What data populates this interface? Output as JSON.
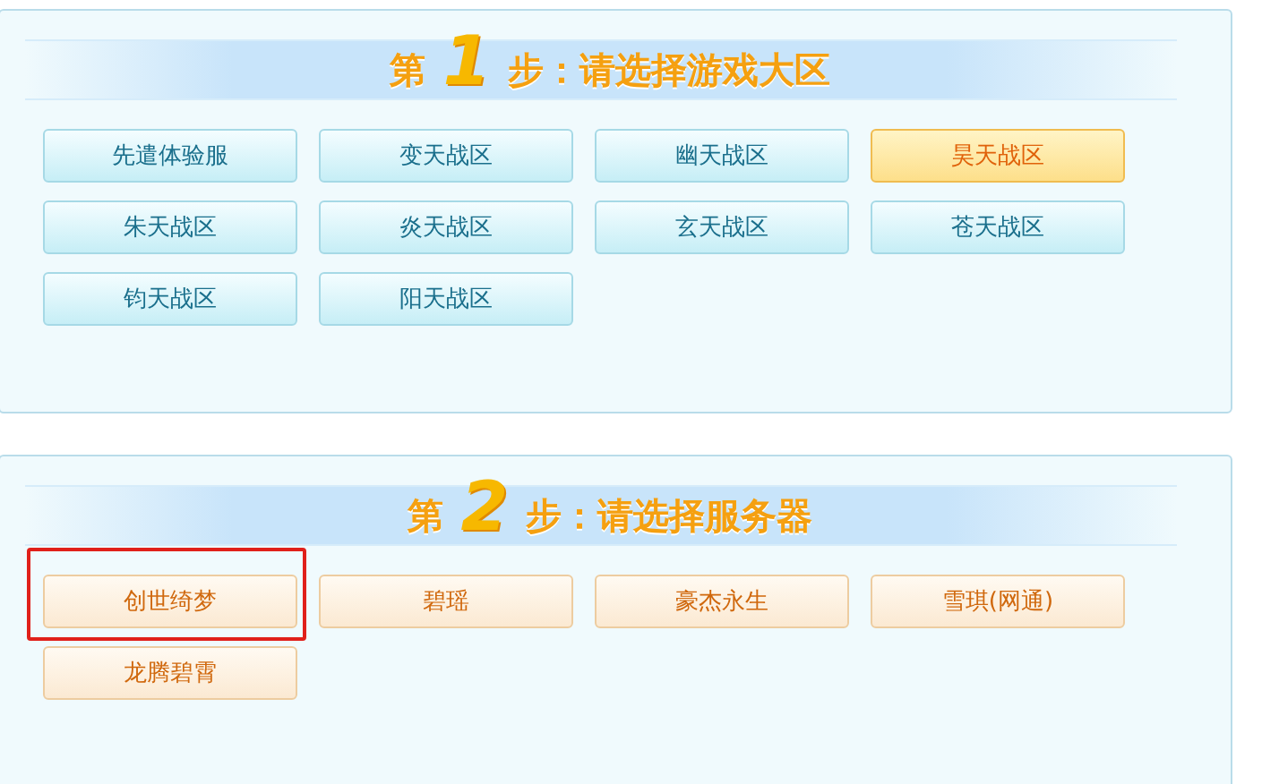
{
  "steps": [
    {
      "prefix": "第",
      "number": "1",
      "title": "步：请选择游戏大区",
      "kind": "zone",
      "options": [
        {
          "label": "先遣体验服",
          "selected": false,
          "highlighted": false
        },
        {
          "label": "变天战区",
          "selected": false,
          "highlighted": false
        },
        {
          "label": "幽天战区",
          "selected": false,
          "highlighted": false
        },
        {
          "label": "昊天战区",
          "selected": true,
          "highlighted": false
        },
        {
          "label": "朱天战区",
          "selected": false,
          "highlighted": false
        },
        {
          "label": "炎天战区",
          "selected": false,
          "highlighted": false
        },
        {
          "label": "玄天战区",
          "selected": false,
          "highlighted": false
        },
        {
          "label": "苍天战区",
          "selected": false,
          "highlighted": false
        },
        {
          "label": "钧天战区",
          "selected": false,
          "highlighted": false
        },
        {
          "label": "阳天战区",
          "selected": false,
          "highlighted": false
        }
      ]
    },
    {
      "prefix": "第",
      "number": "2",
      "title": "步：请选择服务器",
      "kind": "server",
      "options": [
        {
          "label": "创世绮梦",
          "selected": false,
          "highlighted": true
        },
        {
          "label": "碧瑶",
          "selected": false,
          "highlighted": false
        },
        {
          "label": "豪杰永生",
          "selected": false,
          "highlighted": false
        },
        {
          "label": "雪琪(网通)",
          "selected": false,
          "highlighted": false
        },
        {
          "label": "龙腾碧霄",
          "selected": false,
          "highlighted": false
        }
      ]
    }
  ]
}
